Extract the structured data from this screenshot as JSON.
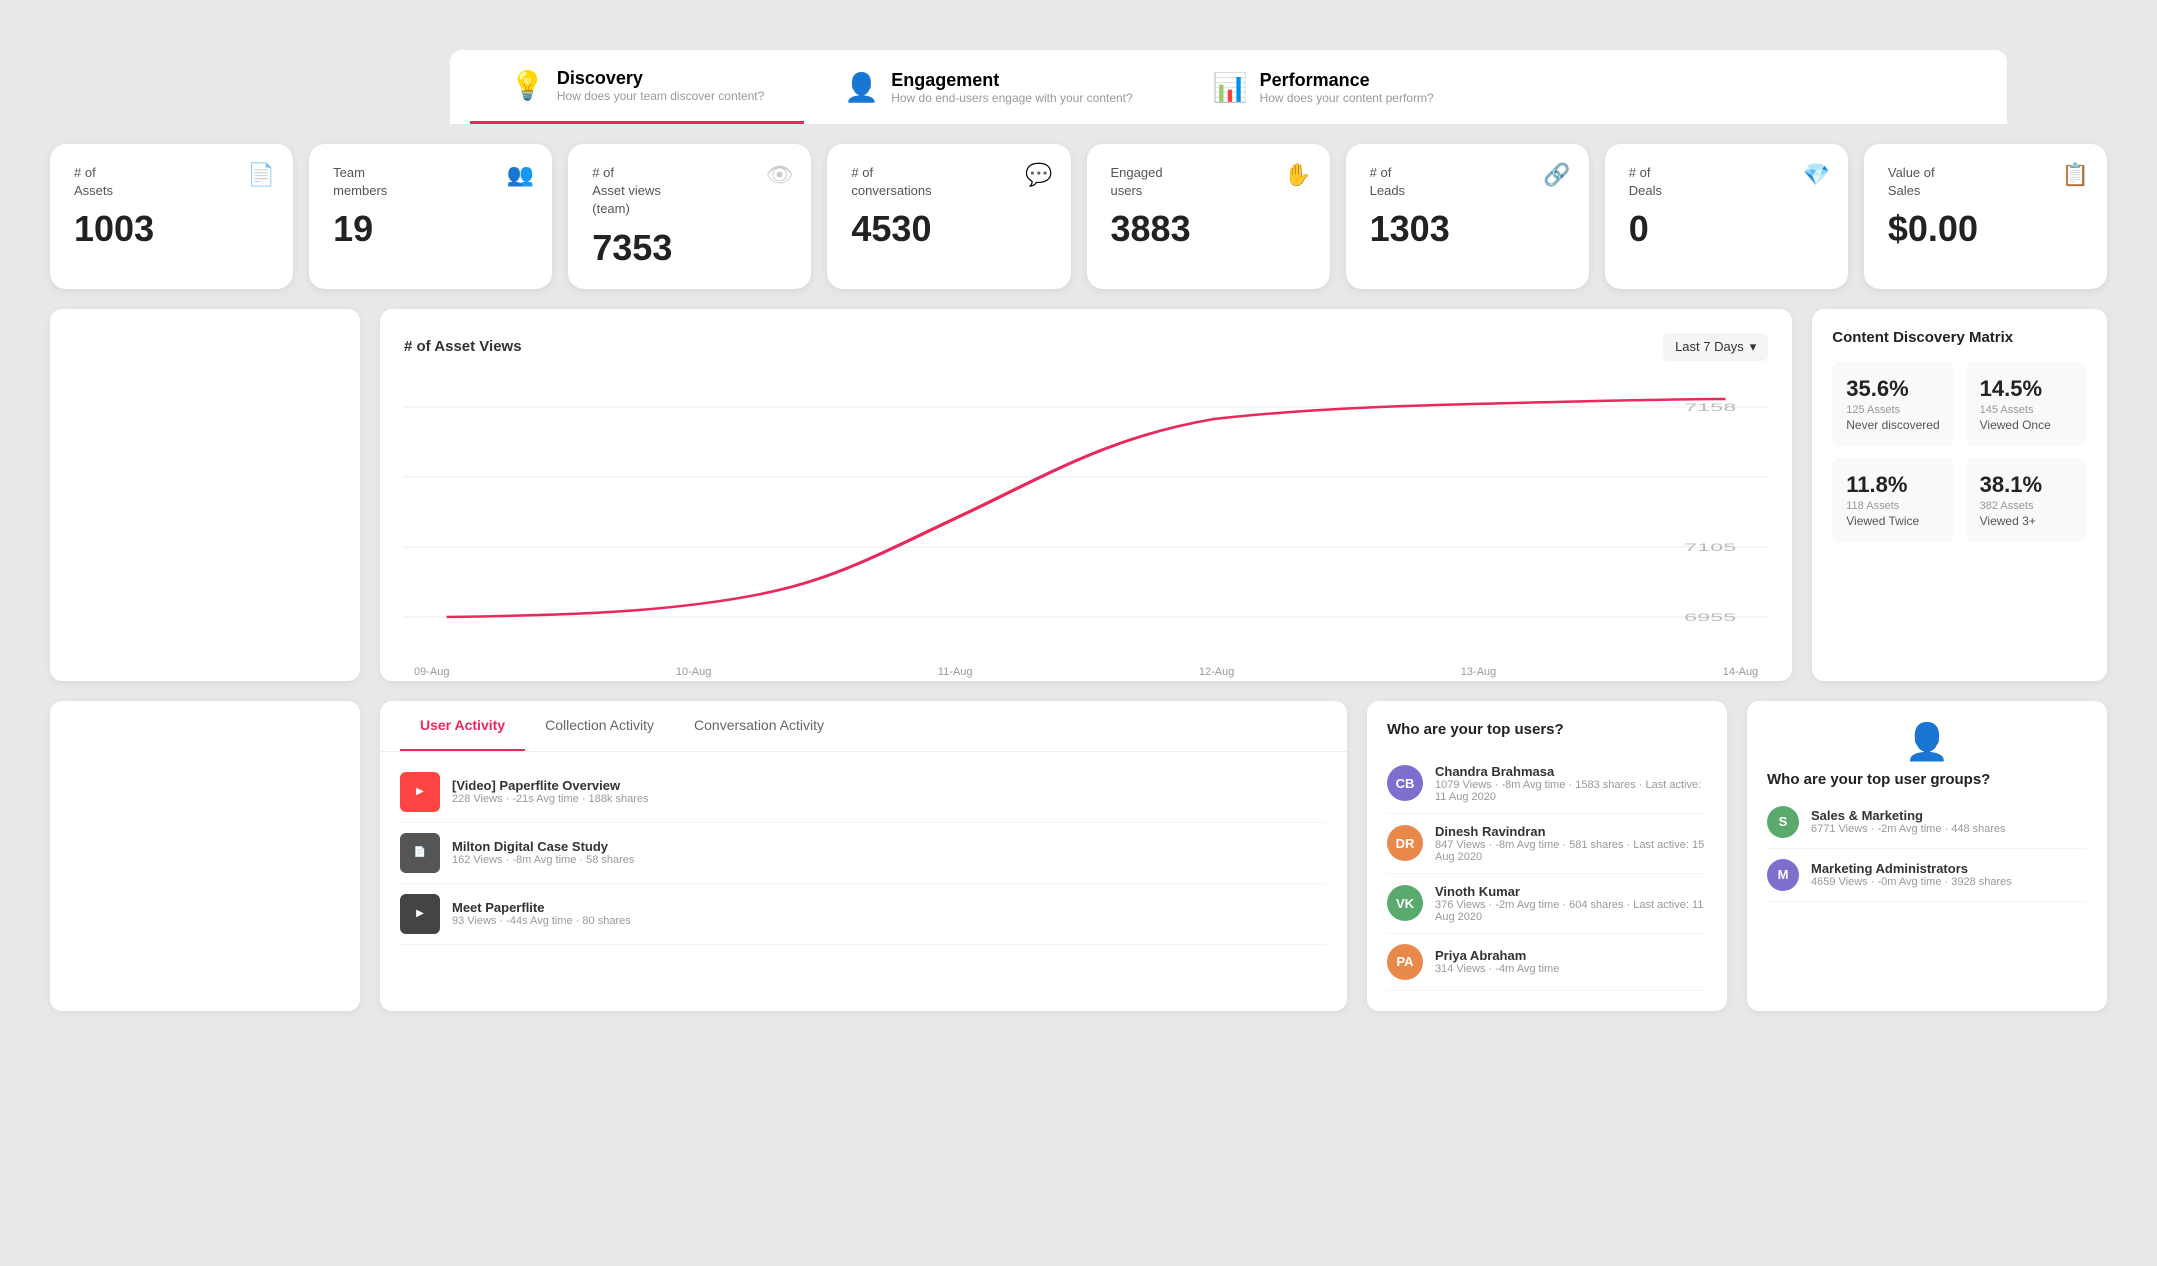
{
  "nav": {
    "tabs": [
      {
        "id": "discovery",
        "icon": "💡",
        "title": "Discovery",
        "subtitle": "How does your team discover content?",
        "active": true
      },
      {
        "id": "engagement",
        "icon": "👤",
        "title": "Engagement",
        "subtitle": "How do end-users engage with your content?",
        "active": false
      },
      {
        "id": "performance",
        "icon": "📊",
        "title": "Performance",
        "subtitle": "How does your content perform?",
        "active": false
      }
    ]
  },
  "metrics": [
    {
      "id": "assets",
      "label": "# of\nAssets",
      "value": "1003",
      "icon": "📄"
    },
    {
      "id": "team",
      "label": "Team\nmembers",
      "value": "19",
      "icon": "👥"
    },
    {
      "id": "asset-views",
      "label": "# of\nAsset views\n(team)",
      "value": "7353",
      "icon": "👁"
    },
    {
      "id": "conversations",
      "label": "# of\nconversations",
      "value": "4530",
      "icon": "💬"
    },
    {
      "id": "engaged-users",
      "label": "Engaged\nusers",
      "value": "3883",
      "icon": "✋"
    },
    {
      "id": "leads",
      "label": "# of\nLeads",
      "value": "1303",
      "icon": "🔗"
    },
    {
      "id": "deals",
      "label": "# of\nDeals",
      "value": "0",
      "icon": "💎"
    },
    {
      "id": "sales",
      "label": "Value of\nSales",
      "value": "$0.00",
      "icon": "📋"
    }
  ],
  "chart": {
    "title": "# of Asset Views",
    "filter_label": "Last 7 Days",
    "y_max": "7158",
    "y_mid": "7105",
    "y_min": "6955",
    "x_labels": [
      "09-Aug",
      "10-Aug",
      "11-Aug",
      "12-Aug",
      "13-Aug",
      "14-Aug"
    ]
  },
  "discovery_matrix": {
    "title": "Content Discovery Matrix",
    "cells": [
      {
        "pct": "35.6%",
        "assets": "125 Assets",
        "label": "Never discovered"
      },
      {
        "pct": "14.5%",
        "assets": "145 Assets",
        "label": "Viewed Once"
      },
      {
        "pct": "11.8%",
        "assets": "118 Assets",
        "label": "Viewed Twice"
      },
      {
        "pct": "38.1%",
        "assets": "382 Assets",
        "label": "Viewed 3+"
      }
    ]
  },
  "activity": {
    "tabs": [
      "User Activity",
      "Collection Activity",
      "Conversation Activity"
    ],
    "active_tab": "User Activity",
    "items": [
      {
        "title": "[Video] Paperflite Overview",
        "meta": "228 Views · -21s Avg time · 188k shares",
        "color": "#ff4444"
      },
      {
        "title": "Milton Digital Case Study",
        "meta": "162 Views · -8m Avg time · 58 shares",
        "color": "#444"
      },
      {
        "title": "Meet Paperflite",
        "meta": "93 Views · -44s Avg time · 80 shares",
        "color": "#333"
      }
    ]
  },
  "top_users": {
    "title": "Who are your top users?",
    "users": [
      {
        "name": "Chandra Brahmasa",
        "meta": "1079 Views · -8m Avg time · 1583 shares · Last active: 11 Aug 2020",
        "color": "#7c6fcd",
        "initials": "CB"
      },
      {
        "name": "Dinesh Ravindran",
        "meta": "847 Views · -8m Avg time · 581 shares · Last active: 15 Aug 2020",
        "color": "#e8884a",
        "initials": "DR"
      },
      {
        "name": "Vinoth Kumar",
        "meta": "376 Views · -2m Avg time · 604 shares · Last active: 11 Aug 2020",
        "color": "#5aaa6e",
        "initials": "VK"
      },
      {
        "name": "Priya Abraham",
        "meta": "314 Views · -4m Avg time",
        "color": "#e8884a",
        "initials": "PA"
      }
    ]
  },
  "top_groups": {
    "title": "Who are your top user groups?",
    "groups": [
      {
        "name": "Sales & Marketing",
        "meta": "6771 Views · -2m Avg time · 448 shares",
        "color": "#5aaa6e",
        "initials": "S"
      },
      {
        "name": "Marketing Administrators",
        "meta": "4659 Views · -0m Avg time · 3928 shares",
        "color": "#7c6fcd",
        "initials": "M"
      }
    ]
  }
}
